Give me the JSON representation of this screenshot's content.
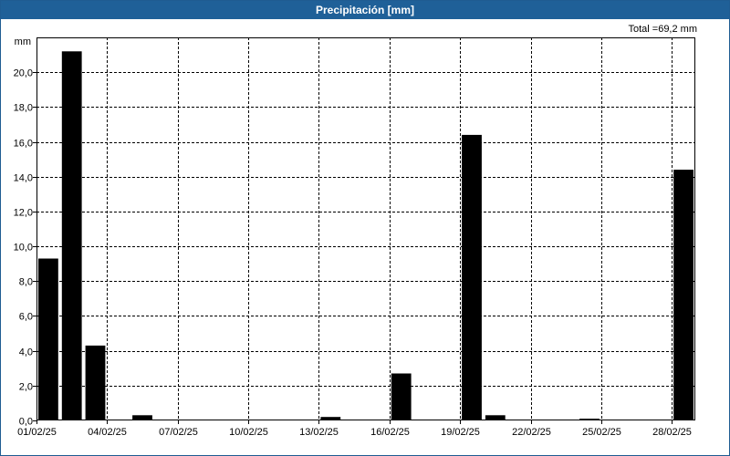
{
  "window": {
    "title": "Precipitación [mm]"
  },
  "summary": {
    "total_label": "Total =69,2 mm"
  },
  "chart_data": {
    "type": "bar",
    "title": "Precipitación [mm]",
    "ylabel": "mm",
    "xlabel": "",
    "ylim": [
      0,
      22
    ],
    "yticks": [
      0,
      2,
      4,
      6,
      8,
      10,
      12,
      14,
      16,
      18,
      20
    ],
    "ytick_labels": [
      "0,0",
      "2,0",
      "4,0",
      "6,0",
      "8,0",
      "10,0",
      "12,0",
      "14,0",
      "16,0",
      "18,0",
      "20,0"
    ],
    "xtick_labels": [
      "01/02/25",
      "04/02/25",
      "07/02/25",
      "10/02/25",
      "13/02/25",
      "16/02/25",
      "19/02/25",
      "22/02/25",
      "25/02/25",
      "28/02/25"
    ],
    "grid": true,
    "bar_color": "#000000",
    "grid_color": "#000000",
    "title_bar_color": "#1f6098",
    "categories": [
      "01/02/25",
      "02/02/25",
      "03/02/25",
      "04/02/25",
      "05/02/25",
      "06/02/25",
      "07/02/25",
      "08/02/25",
      "09/02/25",
      "10/02/25",
      "11/02/25",
      "12/02/25",
      "13/02/25",
      "14/02/25",
      "15/02/25",
      "16/02/25",
      "17/02/25",
      "18/02/25",
      "19/02/25",
      "20/02/25",
      "21/02/25",
      "22/02/25",
      "23/02/25",
      "24/02/25",
      "25/02/25",
      "26/02/25",
      "27/02/25",
      "28/02/25"
    ],
    "values": [
      9.3,
      21.2,
      4.3,
      0,
      0.3,
      0,
      0,
      0,
      0,
      0,
      0,
      0,
      0.2,
      0,
      0,
      2.7,
      0,
      0,
      16.4,
      0.3,
      0,
      0,
      0,
      0.1,
      0,
      0,
      0,
      14.4
    ]
  }
}
